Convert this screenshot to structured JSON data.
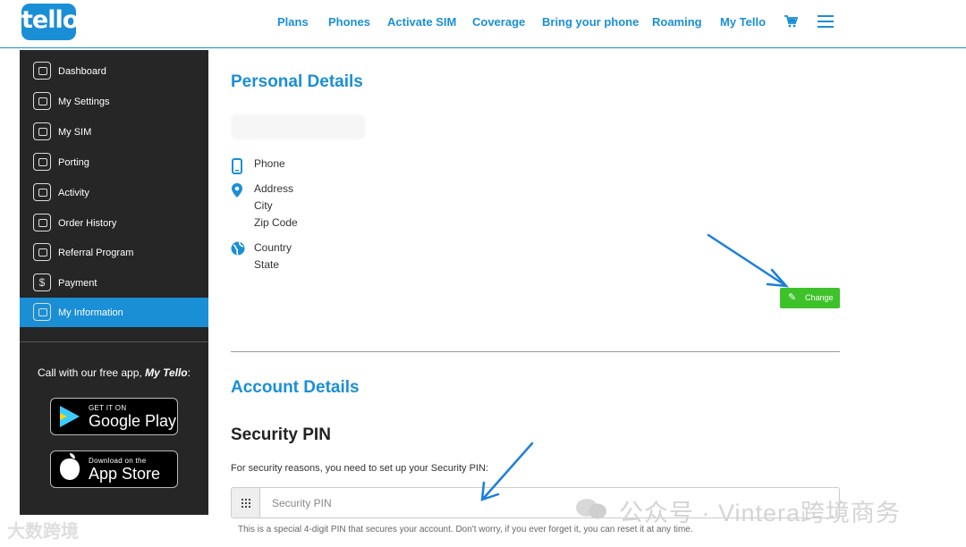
{
  "header": {
    "logo_text": "tello",
    "nav": [
      "Plans",
      "Phones",
      "Activate SIM",
      "Coverage",
      "Bring your phone",
      "Roaming",
      "My Tello"
    ],
    "cart_icon": "cart-icon",
    "menu_icon": "hamburger-menu-icon"
  },
  "sidebar": {
    "items": [
      {
        "label": "Dashboard",
        "icon": "dashboard-icon"
      },
      {
        "label": "My Settings",
        "icon": "settings-icon"
      },
      {
        "label": "My SIM",
        "icon": "sim-icon"
      },
      {
        "label": "Porting",
        "icon": "porting-icon"
      },
      {
        "label": "Activity",
        "icon": "activity-icon"
      },
      {
        "label": "Order History",
        "icon": "order-history-icon"
      },
      {
        "label": "Referral Program",
        "icon": "referral-icon"
      },
      {
        "label": "Payment",
        "icon": "dollar-icon"
      },
      {
        "label": "My Information",
        "icon": "user-icon",
        "active": true
      }
    ],
    "call_text": "Call with our free app,",
    "call_app": "My Tello",
    "call_suffix": ":",
    "google_play": {
      "small": "GET IT ON",
      "big": "Google Play"
    },
    "app_store": {
      "small": "Download on the",
      "big": "App Store"
    }
  },
  "personal": {
    "title": "Personal Details",
    "phone_label": "Phone",
    "address_label": "Address",
    "city_label": "City",
    "zip_label": "Zip Code",
    "country_label": "Country",
    "state_label": "State",
    "change_button": "Change"
  },
  "account": {
    "title": "Account Details",
    "pin_title": "Security PIN",
    "pin_description": "For security reasons, you need to set up your Security PIN:",
    "pin_placeholder": "Security PIN",
    "pin_hint": "This is a special 4-digit PIN that secures your account. Don't worry, if you ever forget it, you can reset it at any time."
  },
  "watermark": {
    "text": "公众号 · Vintera跨境商务",
    "corner": "大数跨境"
  },
  "colors": {
    "brand_blue": "#1a8fd6",
    "sidebar_bg": "#262626",
    "change_green": "#3ec22a",
    "arrow_blue": "#1a7fd8"
  }
}
